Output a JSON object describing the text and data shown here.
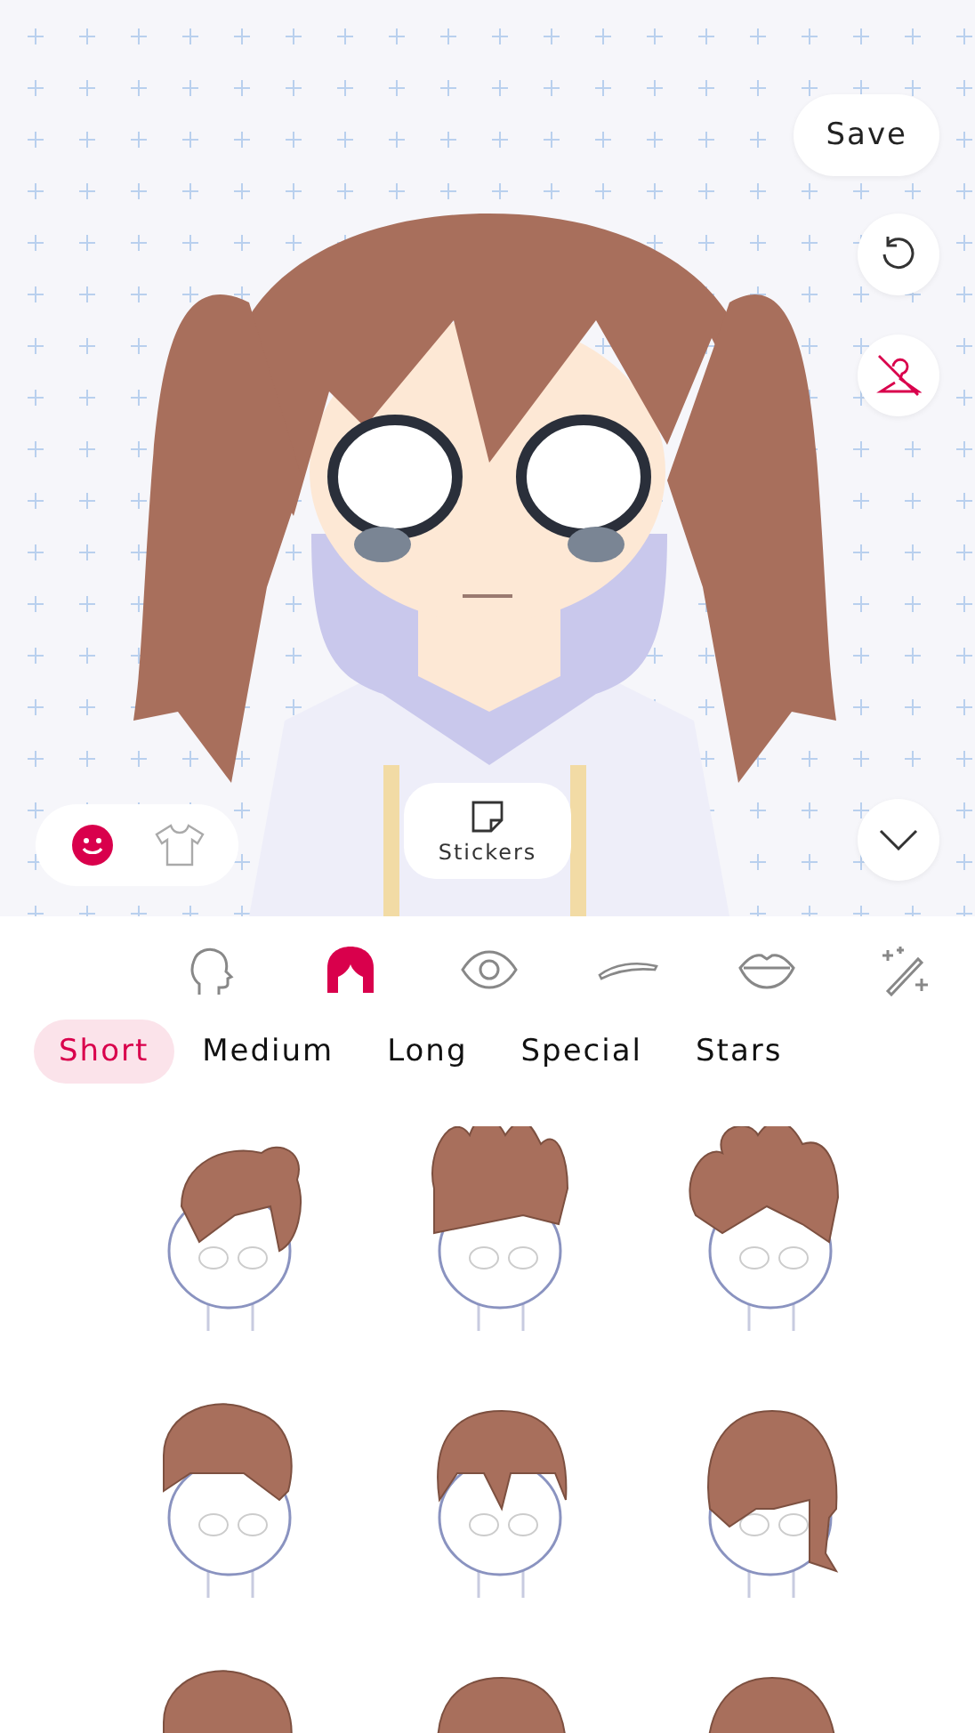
{
  "toolbar": {
    "save": "Save"
  },
  "mode_toggle": [
    {
      "kind": "face",
      "selected": true
    },
    {
      "kind": "clothes",
      "selected": false
    }
  ],
  "stickers": {
    "label": "Stickers"
  },
  "categories": [
    {
      "kind": "head",
      "selected": false
    },
    {
      "kind": "hair",
      "selected": true
    },
    {
      "kind": "eye",
      "selected": false
    },
    {
      "kind": "brow",
      "selected": false
    },
    {
      "kind": "lips",
      "selected": false
    },
    {
      "kind": "magic",
      "selected": false
    }
  ],
  "subtabs": [
    {
      "label": "Short",
      "selected": true
    },
    {
      "label": "Medium",
      "selected": false
    },
    {
      "label": "Long",
      "selected": false
    },
    {
      "label": "Special",
      "selected": false
    },
    {
      "label": "Stars",
      "selected": false
    }
  ]
}
